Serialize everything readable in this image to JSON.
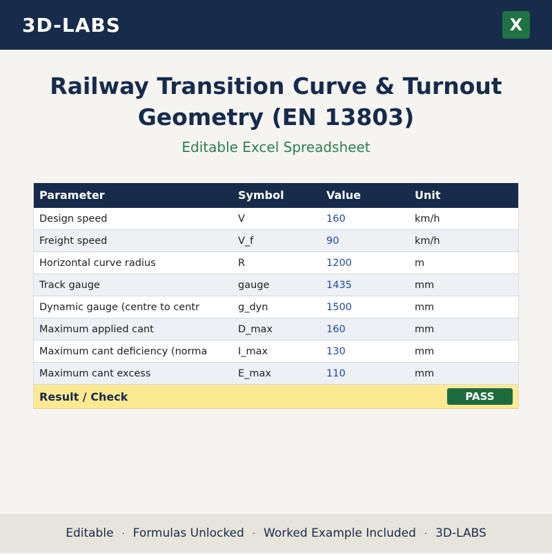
{
  "header": {
    "brand": "3D-LABS",
    "excel_icon_letter": "X"
  },
  "hero": {
    "title": "Railway Transition Curve & Turnout Geometry (EN 13803)",
    "subtitle": "Editable Excel Spreadsheet"
  },
  "table": {
    "columns": [
      "Parameter",
      "Symbol",
      "Value",
      "Unit"
    ],
    "rows": [
      {
        "parameter": "Design speed",
        "symbol": "V",
        "value": "160",
        "unit": "km/h"
      },
      {
        "parameter": "Freight speed",
        "symbol": "V_f",
        "value": "90",
        "unit": "km/h"
      },
      {
        "parameter": "Horizontal curve radius",
        "symbol": "R",
        "value": "1200",
        "unit": "m"
      },
      {
        "parameter": "Track gauge",
        "symbol": "gauge",
        "value": "1435",
        "unit": "mm"
      },
      {
        "parameter": "Dynamic gauge (centre to centr",
        "symbol": "g_dyn",
        "value": "1500",
        "unit": "mm"
      },
      {
        "parameter": "Maximum applied cant",
        "symbol": "D_max",
        "value": "160",
        "unit": "mm"
      },
      {
        "parameter": "Maximum cant deficiency (norma",
        "symbol": "I_max",
        "value": "130",
        "unit": "mm"
      },
      {
        "parameter": "Maximum cant excess",
        "symbol": "E_max",
        "value": "110",
        "unit": "mm"
      }
    ],
    "result_label": "Result / Check",
    "result_status": "PASS"
  },
  "footer": {
    "items": [
      "Editable",
      "Formulas Unlocked",
      "Worked Example Included",
      "3D-LABS"
    ],
    "separator": "·"
  },
  "colors": {
    "navy": "#172b4b",
    "excel_green": "#1f7244",
    "value_blue": "#1e47a0",
    "result_yellow": "#fde992",
    "pass_green": "#1f6b40"
  }
}
